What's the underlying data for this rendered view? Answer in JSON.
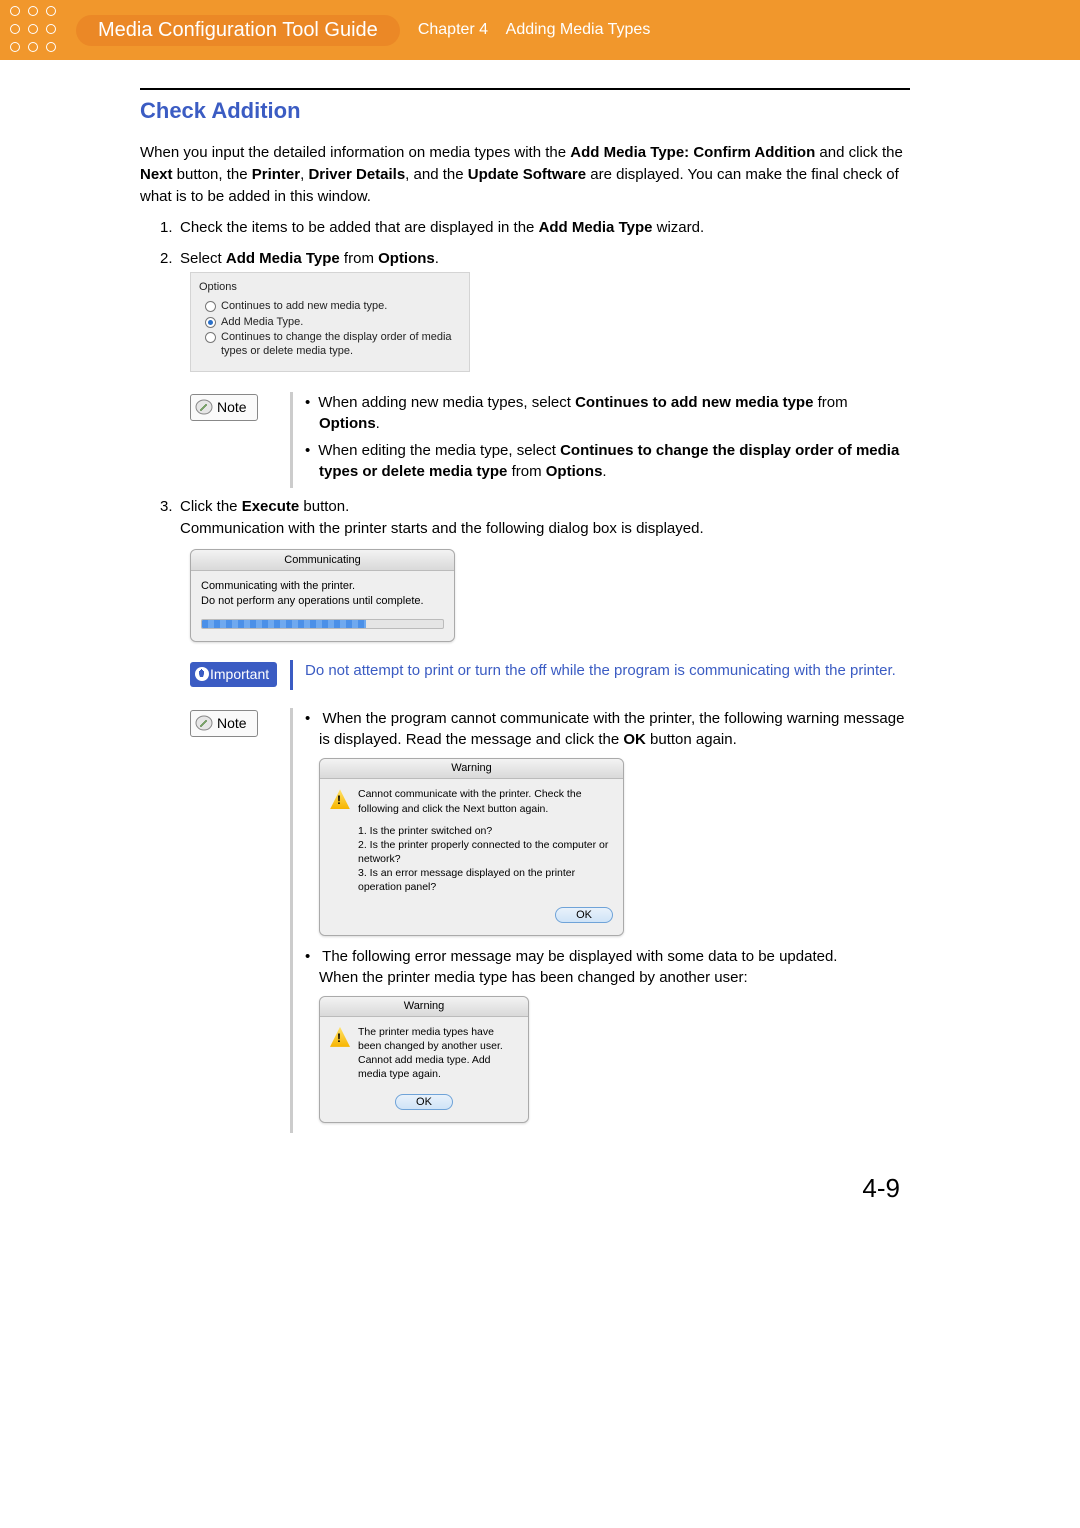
{
  "header": {
    "guide_title": "Media Configuration Tool Guide",
    "chapter_label": "Chapter 4",
    "chapter_name": "Adding Media Types"
  },
  "section_title": "Check Addition",
  "intro": {
    "line1_pre": "When you input the detailed information on media types with the ",
    "line1_bold": "Add Media Type: Confirm Addition",
    "line2_a": " and click the ",
    "line2_b1": "Next",
    "line2_c": " button, the ",
    "line2_b2": "Printer",
    "line2_d": ", ",
    "line2_b3": "Driver Details",
    "line2_e": ", and the ",
    "line2_b4": "Update Software",
    "line2_f": " are displayed. You can make the final check of what is to be added in this window."
  },
  "step1": {
    "num": "1.",
    "pre": "Check the items to be added that are displayed in the ",
    "bold": "Add Media Type",
    "post": " wizard."
  },
  "step2": {
    "num": "2.",
    "pre": "Select ",
    "bold1": "Add Media Type",
    "mid": " from ",
    "bold2": "Options",
    "post": "."
  },
  "options_box": {
    "title": "Options",
    "opt1": "Continues to add new media type.",
    "opt2": "Add Media Type.",
    "opt3": "Continues to change the display order of media types or delete media type."
  },
  "note1": {
    "label": "Note",
    "b1_pre": "When adding new media types, select ",
    "b1_bold": "Continues to add new media type",
    "b1_mid": " from ",
    "b1_bold2": "Options",
    "b1_post": ".",
    "b2_pre": "When editing the media type, select ",
    "b2_bold": "Continues to change the display order of media types or delete media type",
    "b2_mid": " from ",
    "b2_bold2": "Options",
    "b2_post": "."
  },
  "step3": {
    "num": "3.",
    "pre": "Click the ",
    "bold": "Execute",
    "post": " button.",
    "line2": "Communication with the printer starts and the following dialog box is displayed."
  },
  "comm_dialog": {
    "title": "Communicating",
    "line1": "Communicating with the printer.",
    "line2": "Do not perform any operations until complete."
  },
  "important": {
    "label": "Important",
    "text": "Do not attempt to print or turn the off while the program is communicating with the printer."
  },
  "note2": {
    "label": "Note",
    "p1_pre": "When the program cannot communicate with the printer, the following warning message is displayed. Read the message and click the ",
    "p1_bold": "OK",
    "p1_post": " button again.",
    "p2_a": "The following error message may be displayed with some data to be updated.",
    "p2_b": "When the printer media type has been changed by another user:"
  },
  "warn1": {
    "title": "Warning",
    "msg": "Cannot communicate with the printer. Check the following and click the Next button again.",
    "q1": "1. Is the printer switched on?",
    "q2": "2. Is the printer properly connected to the computer or network?",
    "q3": "3. Is an error message displayed on the printer operation panel?",
    "ok": "OK"
  },
  "warn2": {
    "title": "Warning",
    "msg": "The printer media types have been changed by another user.\nCannot add media type. Add media type again.",
    "ok": "OK"
  },
  "page_number": "4-9"
}
